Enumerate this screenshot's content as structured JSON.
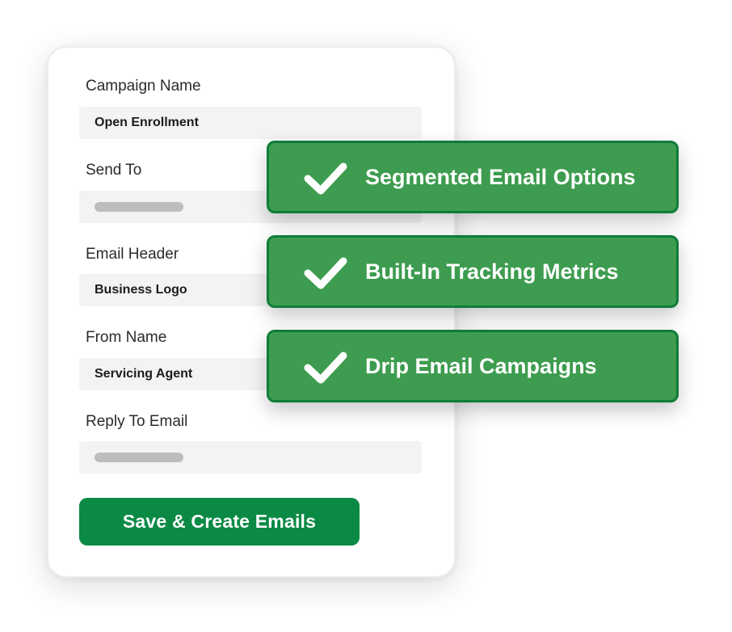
{
  "form": {
    "fields": [
      {
        "label": "Campaign Name",
        "value": "Open Enrollment"
      },
      {
        "label": "Send To",
        "value": ""
      },
      {
        "label": "Email Header",
        "value": "Business Logo"
      },
      {
        "label": "From Name",
        "value": "Servicing Agent"
      },
      {
        "label": "Reply To Email",
        "value": ""
      }
    ],
    "save_label": "Save & Create Emails"
  },
  "features": [
    {
      "label": "Segmented Email Options",
      "icon": "checkmark-icon"
    },
    {
      "label": "Built-In Tracking Metrics",
      "icon": "checkmark-icon"
    },
    {
      "label": "Drip Email Campaigns",
      "icon": "checkmark-icon"
    }
  ],
  "colors": {
    "button_green": "#0b8a45",
    "badge_green": "#3d9c4f",
    "badge_border": "#0f7d39",
    "input_bg": "#f3f3f3"
  }
}
